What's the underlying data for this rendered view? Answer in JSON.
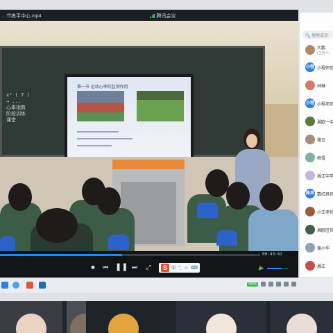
{
  "window": {
    "file_name": "…节练平中心.mp4",
    "meeting_label": "腾讯会议"
  },
  "colors": {
    "accent": "#1e88ff",
    "signal": "#3ecf5b",
    "podium_top": "#e78a3a",
    "chair": "#2d63c9",
    "uniform": "#3c5c48"
  },
  "video": {
    "board_text": [
      "x² ( 7 )",
      "    → ...",
      "心率指数",
      "阶段训练",
      "课堂"
    ],
    "slide_title": "第一节 运动心率的监测作用"
  },
  "player": {
    "time": "00:43:42",
    "progress": 0.47,
    "volume": 0.7,
    "icons": [
      "stop-icon",
      "prev-icon",
      "pause-icon",
      "next-icon",
      "fullscreen-icon"
    ]
  },
  "ime_bar": {
    "logo": "S",
    "items": [
      "中",
      "°,",
      "☺",
      "⌨"
    ]
  },
  "panel": {
    "search_placeholder": "搜索成员",
    "participants": [
      {
        "name": "大鹏",
        "sub": "(主持人)",
        "color": "#b08b6a",
        "initial": ""
      },
      {
        "name": "小程师范",
        "color": "#2f7ee6",
        "initial": "小程"
      },
      {
        "name": "林琳",
        "color": "#d87a6a",
        "initial": ""
      },
      {
        "name": "小程老师",
        "color": "#2f7ee6",
        "initial": "小程"
      },
      {
        "name": "湘欧一中",
        "color": "#5b7a3e",
        "initial": ""
      },
      {
        "name": "雅云",
        "color": "#a58f7c",
        "initial": ""
      },
      {
        "name": "梅雪",
        "color": "#7fb2a0",
        "initial": ""
      },
      {
        "name": "湘江中学",
        "color": "#c7b7e0",
        "initial": ""
      },
      {
        "name": "戴红异师",
        "color": "#2f7ee6",
        "initial": "陈异"
      },
      {
        "name": "小江老师",
        "color": "#9c5b3c",
        "initial": ""
      },
      {
        "name": "湘欧区师",
        "color": "#3f5f4a",
        "initial": ""
      },
      {
        "name": "黄小华",
        "color": "#8fa2b8",
        "initial": ""
      },
      {
        "name": "湘江",
        "color": "#c94c4c",
        "initial": ""
      }
    ]
  },
  "taskbar": {
    "battery": "95%",
    "icons": [
      "start-icon",
      "browser-icon",
      "ppt-icon",
      "word-icon"
    ]
  },
  "tiles": [
    {
      "name": "tile-teacher",
      "bg": "#3a3d44",
      "avatar": "#e9d3c3"
    },
    {
      "name": "tile-cabinet",
      "bg": "#4b4f55",
      "avatar": "#7e6f61"
    },
    {
      "name": "tile-candle",
      "bg": "#1e2229",
      "avatar": "#e4a43d"
    },
    {
      "name": "tile-cartoon",
      "bg": "#2b2f37",
      "avatar": "#f0e6dc"
    },
    {
      "name": "tile-girl",
      "bg": "#2b2f37",
      "avatar": "#eadcd6"
    }
  ]
}
